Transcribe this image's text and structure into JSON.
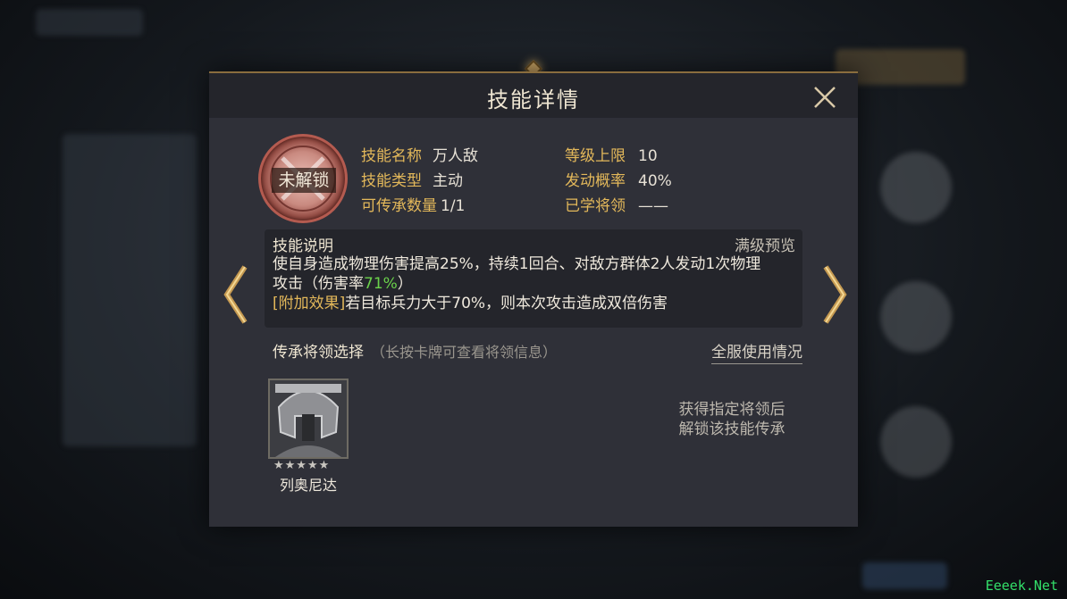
{
  "dialog": {
    "title": "技能详情"
  },
  "skill": {
    "lock_label": "未解锁",
    "name_key": "技能名称",
    "name_val": "万人敌",
    "type_key": "技能类型",
    "type_val": "主动",
    "inherit_key": "可传承数量",
    "inherit_val": "1/1",
    "level_key": "等级上限",
    "level_val": "10",
    "chance_key": "发动概率",
    "chance_val": "40%",
    "learned_key": "已学将领",
    "learned_val": "——"
  },
  "description": {
    "heading": "技能说明",
    "preview": "满级预览",
    "line1": "使自身造成物理伤害提高25%，持续1回合、对敌方群体2人发动1次物理",
    "line2a": "攻击（伤害率",
    "line2rate": "71%",
    "line2b": "）",
    "extra_tag": "[附加效果]",
    "extra_text": "若目标兵力大于70%，则本次攻击造成双倍伤害"
  },
  "heir": {
    "title": "传承将领选择",
    "hint": "（长按卡牌可查看将领信息）",
    "usage": "全服使用情况",
    "card_stars": "★★★★★",
    "card_name": "列奥尼达",
    "unlock_note_1": "获得指定将领后",
    "unlock_note_2": "解锁该技能传承"
  },
  "watermark": "Eeeek.Net",
  "colors": {
    "gold": "#e3b85a",
    "green": "#6bd24b",
    "panel": "#2f3038"
  }
}
